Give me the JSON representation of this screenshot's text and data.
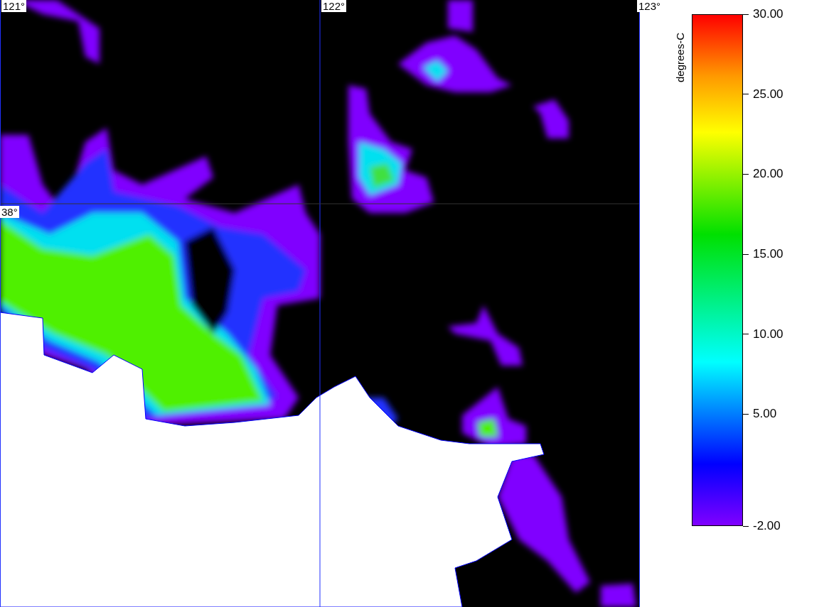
{
  "map": {
    "longitude_labels": [
      "121°",
      "122°",
      "123°"
    ],
    "latitude_labels": [
      "38°"
    ]
  },
  "colorbar": {
    "title": "degrees-C",
    "ticks": [
      "30.00",
      "25.00",
      "20.00",
      "15.00",
      "10.00",
      "5.00",
      "-2.00"
    ]
  }
}
